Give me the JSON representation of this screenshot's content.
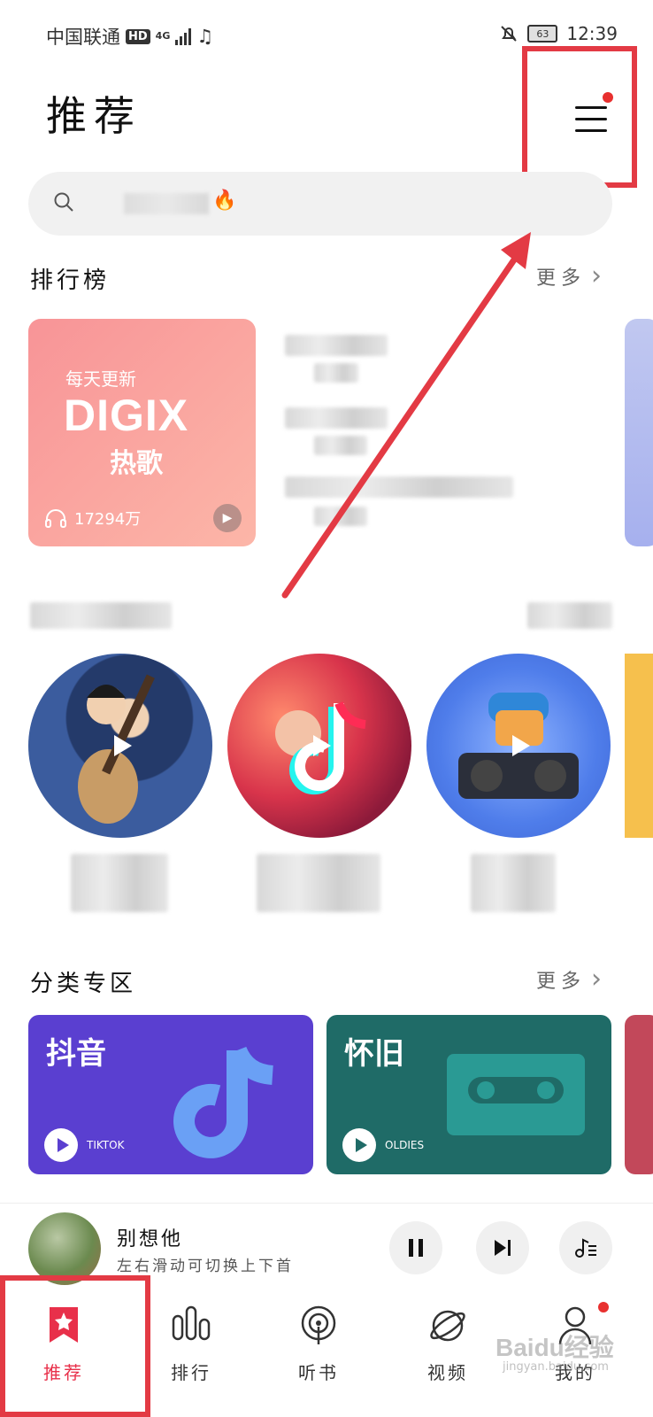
{
  "status": {
    "carrier": "中国联通",
    "hd": "HD",
    "net": "4G",
    "battery": "63",
    "time": "12:39"
  },
  "header": {
    "title": "推荐"
  },
  "search": {
    "placeholder": ""
  },
  "charts": {
    "title": "排行榜",
    "more": "更多",
    "card": {
      "subtitle": "每天更新",
      "brand": "DIGIX",
      "name": "热歌",
      "plays": "17294万"
    }
  },
  "categories": {
    "title": "分类专区",
    "more": "更多",
    "items": [
      {
        "name": "抖音",
        "tag": "TIKTOK",
        "color": "#5a3fd0"
      },
      {
        "name": "怀旧",
        "tag": "OLDIES",
        "color": "#1f6b67"
      }
    ]
  },
  "player": {
    "song": "别想他",
    "hint": "左右滑动可切换上下首"
  },
  "tabs": [
    {
      "label": "推荐",
      "icon": "star-bookmark-icon",
      "active": true
    },
    {
      "label": "排行",
      "icon": "bar-chart-icon",
      "active": false
    },
    {
      "label": "听书",
      "icon": "podcast-icon",
      "active": false
    },
    {
      "label": "视频",
      "icon": "planet-icon",
      "active": false
    },
    {
      "label": "我的",
      "icon": "user-icon",
      "active": false
    }
  ],
  "watermark": {
    "brand": "Baidu经验",
    "url": "jingyan.baidu.com"
  },
  "colors": {
    "accent": "#e8304a",
    "highlight_box": "#e33a44"
  }
}
